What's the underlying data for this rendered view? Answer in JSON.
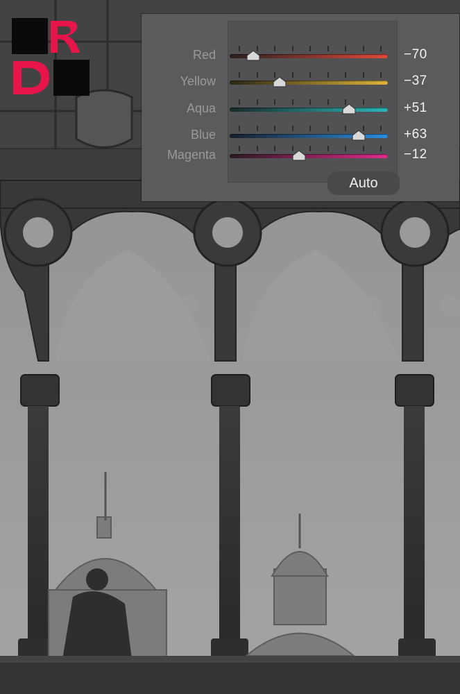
{
  "panel": {
    "sliders": [
      {
        "label": "Red",
        "value": "−70",
        "level": -70,
        "track_from": "#2a2020",
        "track_to": "#e04a3a"
      },
      {
        "label": "Yellow",
        "value": "−37",
        "level": -37,
        "track_from": "#2a2818",
        "track_to": "#e0b43a"
      },
      {
        "label": "Aqua",
        "value": "+51",
        "level": 51,
        "track_from": "#1a2a2a",
        "track_to": "#2ab8b8"
      },
      {
        "label": "Blue",
        "value": "+63",
        "level": 63,
        "track_from": "#1a1e2a",
        "track_to": "#2a8ee0"
      },
      {
        "label": "Magenta",
        "value": "−12",
        "level": -12,
        "track_from": "#2a1a22",
        "track_to": "#e02a8a"
      }
    ],
    "auto_label": "Auto"
  },
  "colors": {
    "panel_bg": "#5b5b5d",
    "logo_red": "#e8154a",
    "logo_black": "#0a0a0a"
  },
  "icons": {
    "logo": "rd-logo-icon",
    "thumb": "slider-thumb-icon"
  }
}
